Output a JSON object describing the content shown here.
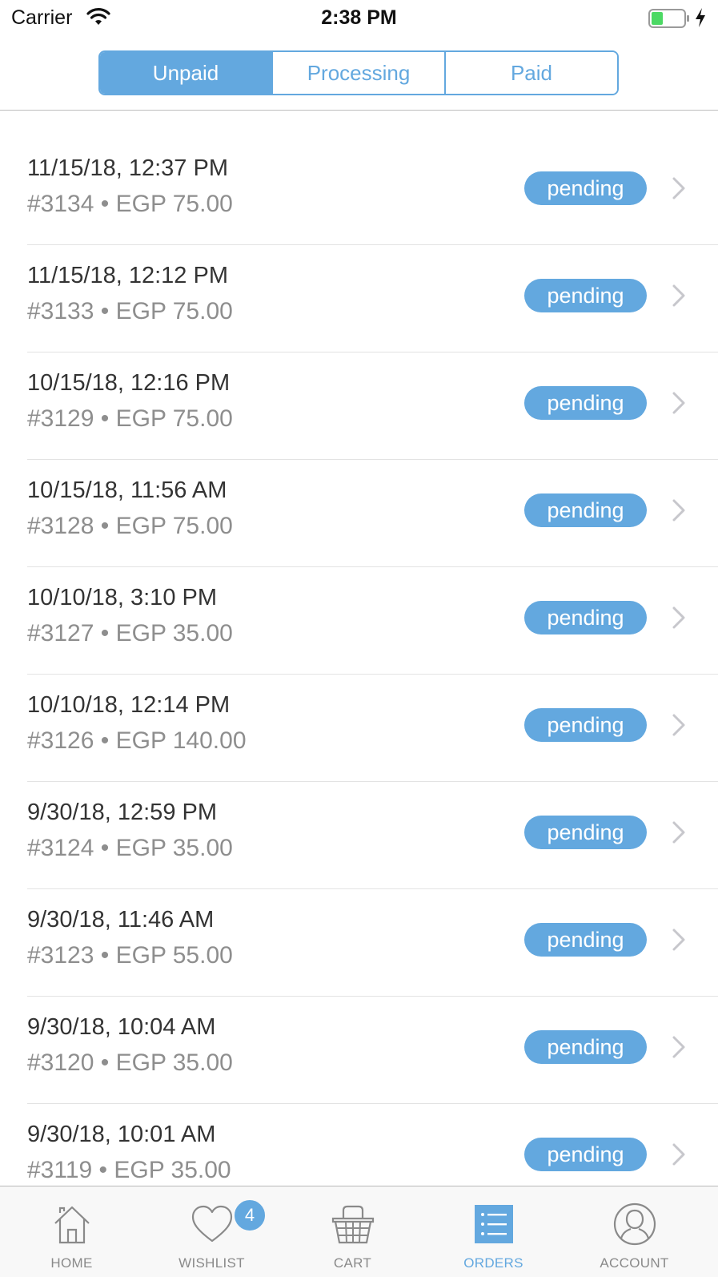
{
  "status_bar": {
    "carrier": "Carrier",
    "time": "2:38 PM",
    "icons": [
      "wifi-icon",
      "battery-icon",
      "charging-bolt-icon"
    ]
  },
  "segments": {
    "items": [
      {
        "label": "Unpaid",
        "active": true
      },
      {
        "label": "Processing",
        "active": false
      },
      {
        "label": "Paid",
        "active": false
      }
    ]
  },
  "orders": [
    {
      "date": "11/15/18, 12:37 PM",
      "meta": "#3134 • EGP 75.00",
      "status": "pending"
    },
    {
      "date": "11/15/18, 12:12 PM",
      "meta": "#3133 • EGP 75.00",
      "status": "pending"
    },
    {
      "date": "10/15/18, 12:16 PM",
      "meta": "#3129 • EGP 75.00",
      "status": "pending"
    },
    {
      "date": "10/15/18, 11:56 AM",
      "meta": "#3128 • EGP 75.00",
      "status": "pending"
    },
    {
      "date": "10/10/18, 3:10 PM",
      "meta": "#3127 • EGP 35.00",
      "status": "pending"
    },
    {
      "date": "10/10/18, 12:14 PM",
      "meta": "#3126 • EGP 140.00",
      "status": "pending"
    },
    {
      "date": "9/30/18, 12:59 PM",
      "meta": "#3124 • EGP 35.00",
      "status": "pending"
    },
    {
      "date": "9/30/18, 11:46 AM",
      "meta": "#3123 • EGP 55.00",
      "status": "pending"
    },
    {
      "date": "9/30/18, 10:04 AM",
      "meta": "#3120 • EGP 35.00",
      "status": "pending"
    },
    {
      "date": "9/30/18, 10:01 AM",
      "meta": "#3119 • EGP 35.00",
      "status": "pending"
    }
  ],
  "tab_bar": {
    "items": [
      {
        "label": "HOME",
        "icon": "home-icon",
        "active": false
      },
      {
        "label": "WISHLIST",
        "icon": "heart-icon",
        "active": false
      },
      {
        "label": "CART",
        "icon": "basket-icon",
        "active": false
      },
      {
        "label": "ORDERS",
        "icon": "orders-list-icon",
        "active": true
      },
      {
        "label": "ACCOUNT",
        "icon": "account-icon",
        "active": false
      }
    ],
    "wishlist_badge": "4"
  },
  "colors": {
    "accent": "#63a8df",
    "text_primary": "#333333",
    "text_secondary": "#8e8e8e",
    "chevron": "#c7c7cc",
    "tab_inactive": "#8a8a8a",
    "battery_fill": "#4cd964"
  }
}
